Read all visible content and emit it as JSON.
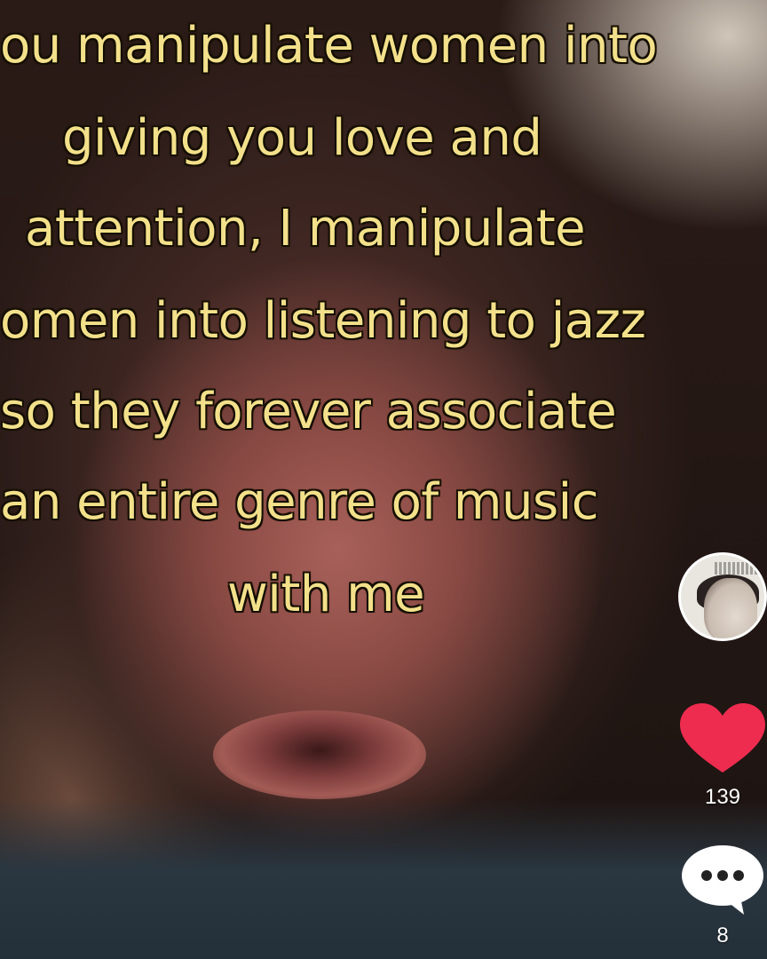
{
  "caption": {
    "lines": [
      "ou manipulate women into",
      "giving you love and",
      "attention, I manipulate",
      "omen into listening to jazz",
      "so they forever associate",
      "an entire genre of music",
      "with me"
    ]
  },
  "sidebar": {
    "avatar_icon": "profile-avatar",
    "like": {
      "icon": "heart-icon",
      "count": "139",
      "color": "#ee2c4f"
    },
    "comment": {
      "icon": "comment-bubble-icon",
      "count": "8",
      "color": "#ffffff"
    }
  },
  "colors": {
    "caption_text": "#f3e08a",
    "caption_outline": "#1a1200"
  }
}
